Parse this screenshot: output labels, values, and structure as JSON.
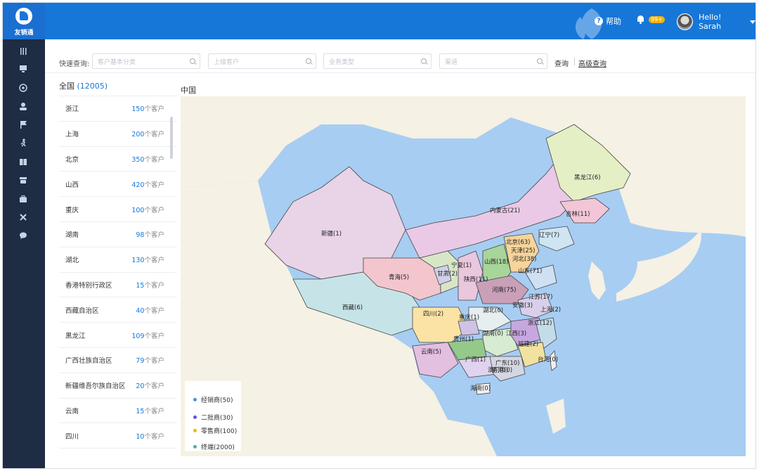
{
  "app": {
    "logo_text": "友销通"
  },
  "header": {
    "help_label": "帮助",
    "notify_badge": "99+",
    "greeting": "Hello! Sarah"
  },
  "sidenav": {
    "icons": [
      "menu-icon",
      "monitor-icon",
      "target-icon",
      "user-icon",
      "flag-icon",
      "runner-icon",
      "book-icon",
      "store-icon",
      "briefcase-icon",
      "tools-icon",
      "chat-icon"
    ]
  },
  "filters": {
    "label": "快速查询:",
    "inputs": [
      {
        "placeholder": "客户基本分类"
      },
      {
        "placeholder": "上级客户"
      },
      {
        "placeholder": "业务类型"
      },
      {
        "placeholder": "渠道"
      }
    ],
    "query_label": "查询",
    "advanced_label": "高级查询"
  },
  "regions": {
    "header_label": "全国",
    "header_count": "(12005)",
    "unit": "个客户",
    "items": [
      {
        "name": "浙江",
        "count": "150"
      },
      {
        "name": "上海",
        "count": "200"
      },
      {
        "name": "北京",
        "count": "350"
      },
      {
        "name": "山西",
        "count": "420"
      },
      {
        "name": "重庆",
        "count": "100"
      },
      {
        "name": "湖南",
        "count": "98"
      },
      {
        "name": "湖北",
        "count": "130"
      },
      {
        "name": "香港特别行政区",
        "count": "15"
      },
      {
        "name": "西藏自治区",
        "count": "40"
      },
      {
        "name": "黑龙江",
        "count": "109"
      },
      {
        "name": "广西壮族自治区",
        "count": "79"
      },
      {
        "name": "新疆维吾尔族自治区",
        "count": "20"
      },
      {
        "name": "云南",
        "count": "15"
      },
      {
        "name": "四川",
        "count": "10"
      }
    ]
  },
  "map": {
    "title": "中国",
    "labels": [
      {
        "text": "黑龙江(6)"
      },
      {
        "text": "内蒙古(21)"
      },
      {
        "text": "吉林(11)"
      },
      {
        "text": "辽宁(7)"
      },
      {
        "text": "新疆(1)"
      },
      {
        "text": "北京(63)"
      },
      {
        "text": "天津(25)"
      },
      {
        "text": "河北(38)"
      },
      {
        "text": "山西(18)"
      },
      {
        "text": "宁夏(1)"
      },
      {
        "text": "山东(71)"
      },
      {
        "text": "青海(5)"
      },
      {
        "text": "甘肃(2)"
      },
      {
        "text": "陕西(11)"
      },
      {
        "text": "河南(75)"
      },
      {
        "text": "江苏(17)"
      },
      {
        "text": "西藏(6)"
      },
      {
        "text": "安徽(3)"
      },
      {
        "text": "上海(2)"
      },
      {
        "text": "四川(2)"
      },
      {
        "text": "湖北(0)"
      },
      {
        "text": "重庆(1)"
      },
      {
        "text": "浙江(12)"
      },
      {
        "text": "湖南(0)"
      },
      {
        "text": "江西(3)"
      },
      {
        "text": "贵州(1)"
      },
      {
        "text": "福建(2)"
      },
      {
        "text": "云南(5)"
      },
      {
        "text": "广西(1)"
      },
      {
        "text": "广东(10)"
      },
      {
        "text": "台湾(0)"
      },
      {
        "text": "香港(0)"
      },
      {
        "text": "澳门(0)"
      },
      {
        "text": "海南(0)"
      }
    ],
    "legend": [
      {
        "label": "经销商(50)",
        "color": "#4a90e2"
      },
      {
        "label": "二批商(30)",
        "color": "#6a4fd6"
      },
      {
        "label": "零售商(100)",
        "color": "#f5b400"
      },
      {
        "label": "终端(2000)",
        "color": "#4fb39a"
      }
    ]
  },
  "colors": {
    "header": "#1677d9",
    "sidenav": "#1e2c44",
    "accent": "#1677d9",
    "sea": "#a7cdf3"
  }
}
